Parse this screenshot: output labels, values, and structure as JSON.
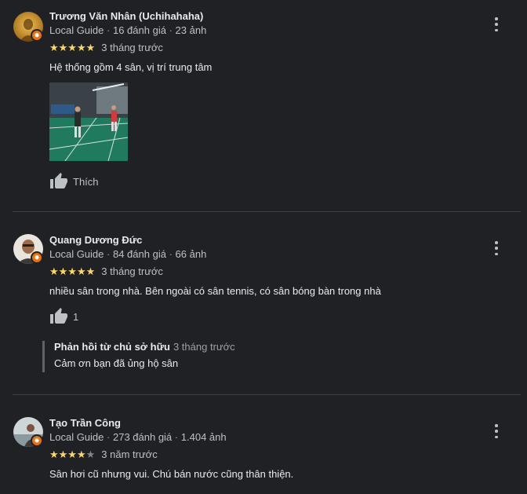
{
  "reviews": [
    {
      "author": "Trương Văn Nhân (Uchihahaha)",
      "guide_label": "Local Guide",
      "review_count": "16 đánh giá",
      "photo_count": "23 ảnh",
      "rating": 5,
      "stars_text": "★★★★★",
      "time": "3 tháng trước",
      "text": "Hệ thống gồm 4 sân, vị trí trung tâm",
      "like_label": "Thích",
      "avatar_icon": "avatar-image",
      "has_photo": true
    },
    {
      "author": "Quang Dương Đức",
      "guide_label": "Local Guide",
      "review_count": "84 đánh giá",
      "photo_count": "66 ảnh",
      "rating": 5,
      "stars_text": "★★★★★",
      "time": "3 tháng trước",
      "text": "nhiều sân trong nhà. Bên ngoài có sân tennis, có sân bóng bàn trong nhà",
      "like_count": "1",
      "owner_reply": {
        "heading": "Phản hồi từ chủ sở hữu",
        "time": "3 tháng trước",
        "text": "Cảm ơn bạn đã ủng hộ sân"
      }
    },
    {
      "author": "Tạo Trần Công",
      "guide_label": "Local Guide",
      "review_count": "273 đánh giá",
      "photo_count": "1.404 ảnh",
      "rating": 4,
      "stars_on": "★★★★",
      "stars_off": "★",
      "time": "3 năm trước",
      "text": "Sân hơi cũ nhưng vui. Chú bán nước cũng thân thiện."
    }
  ],
  "separator": "·",
  "colors": {
    "background": "#202124",
    "star": "#fdd663",
    "badge": "#e8710a"
  }
}
